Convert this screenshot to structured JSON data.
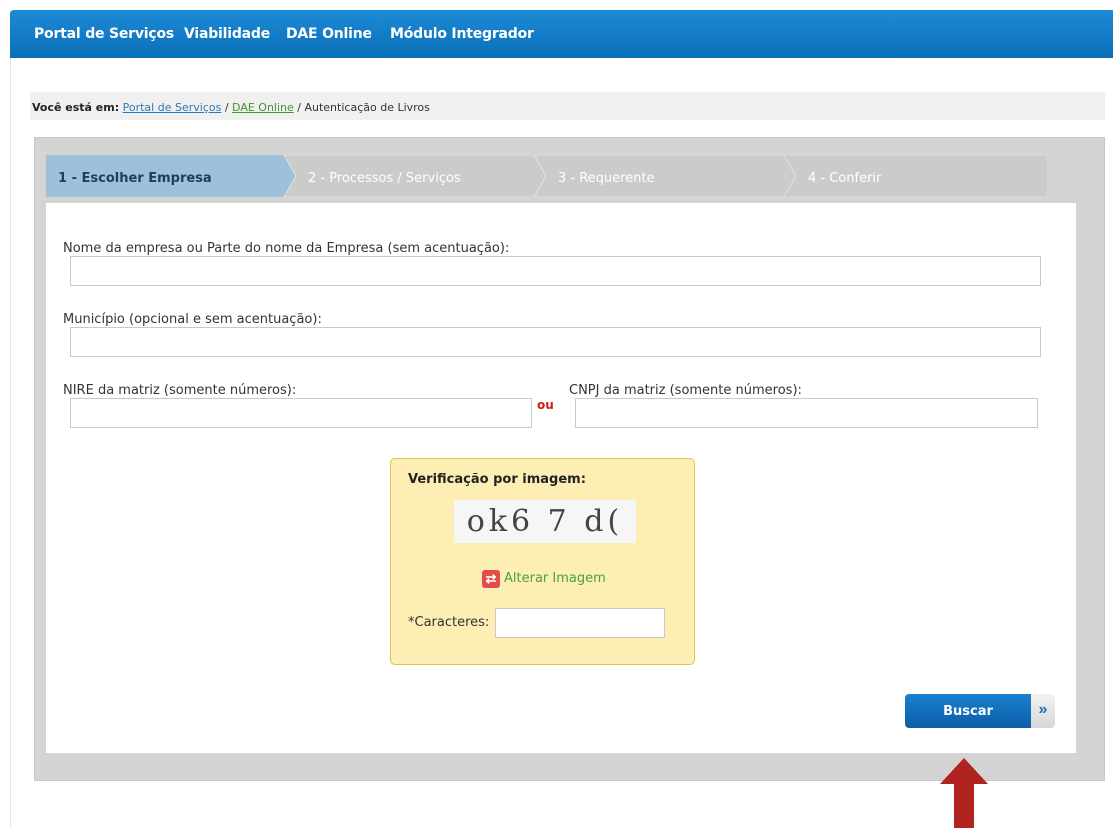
{
  "topnav": {
    "items": [
      "Portal de Serviços",
      "Viabilidade",
      "DAE Online",
      "Módulo Integrador"
    ]
  },
  "breadcrumb": {
    "prefix": "Você está em:",
    "link1": "Portal de Serviços",
    "sep": "/",
    "link2": "DAE Online",
    "current": "/ Autenticação de Livros"
  },
  "steps": [
    {
      "label": "1 - Escolher Empresa",
      "active": true
    },
    {
      "label": "2 - Processos / Serviços",
      "active": false
    },
    {
      "label": "3 - Requerente",
      "active": false
    },
    {
      "label": "4 - Conferir",
      "active": false
    }
  ],
  "form": {
    "company_label": "Nome da empresa ou Parte do nome da Empresa (sem acentuação):",
    "company_value": "",
    "city_label": "Município (opcional e sem acentuação):",
    "city_value": "",
    "nire_label": "NIRE da matriz (somente números):",
    "nire_value": "",
    "or_text": "ou",
    "cnpj_label": "CNPJ da matriz (somente números):",
    "cnpj_value": ""
  },
  "captcha": {
    "title": "Verificação por imagem:",
    "image_text": "ok6 7 d(",
    "refresh_label": "Alterar Imagem",
    "chars_label": "*Caracteres:",
    "chars_value": ""
  },
  "submit": {
    "label": "Buscar",
    "arrow": "»"
  },
  "colors": {
    "nav_blue": "#0b6fb8",
    "step_active": "#9dc1d8",
    "step_inactive": "#cbcbcb",
    "or_red": "#d21b1b",
    "captcha_bg": "#fdeeb4",
    "link_green": "#3b9a2a",
    "annotation_arrow": "#b0231f"
  }
}
